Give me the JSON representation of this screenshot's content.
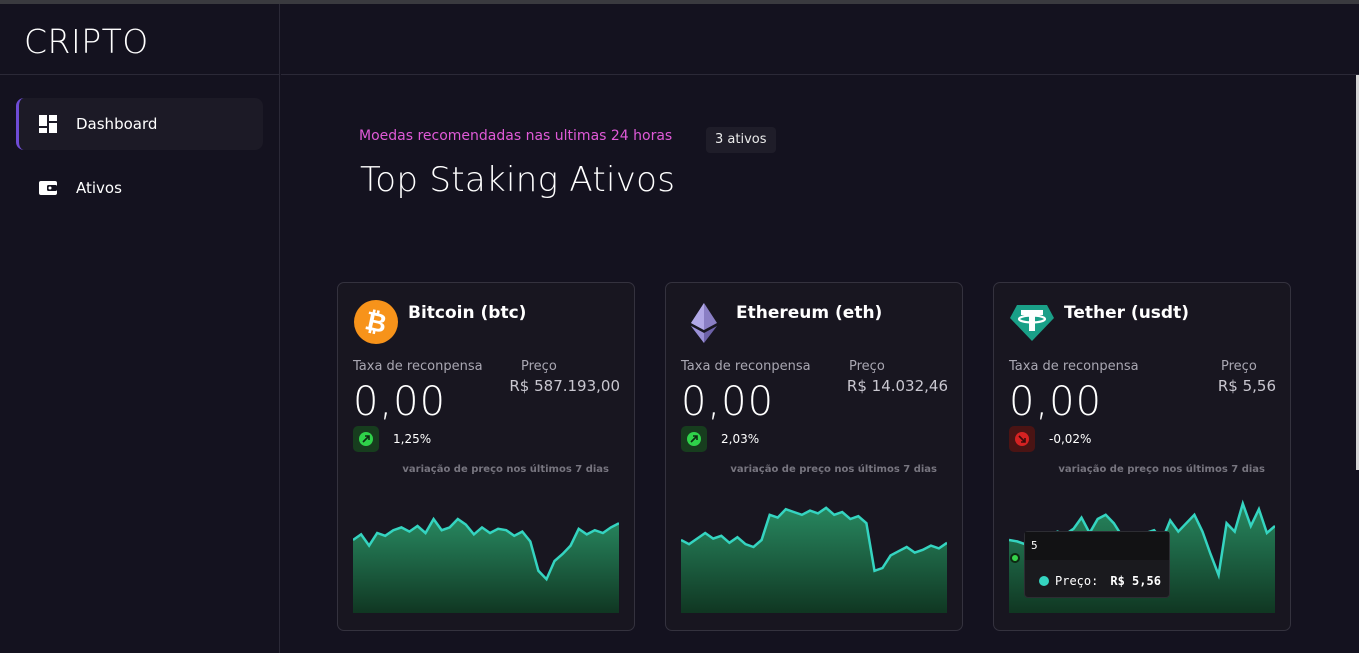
{
  "app": {
    "brand": "CRIPTO"
  },
  "sidebar": {
    "items": [
      {
        "label": "Dashboard",
        "icon": "dashboard-icon",
        "active": true
      },
      {
        "label": "Ativos",
        "icon": "wallet-icon",
        "active": false
      }
    ]
  },
  "header": {
    "subtitle": "Moedas recomendadas nas ultimas 24 horas",
    "badge": "3 ativos",
    "title": "Top Staking Ativos"
  },
  "labels": {
    "reward": "Taxa de reconpensa",
    "price": "Preço",
    "chart_note": "variação de preço nos últimos 7 dias"
  },
  "cards": [
    {
      "name": "Bitcoin (btc)",
      "icon": "bitcoin-icon",
      "reward": "0,00",
      "price": "R$ 587.193,00",
      "change": "1,25%",
      "direction": "up"
    },
    {
      "name": "Ethereum (eth)",
      "icon": "ethereum-icon",
      "reward": "0,00",
      "price": "R$ 14.032,46",
      "change": "2,03%",
      "direction": "up"
    },
    {
      "name": "Tether (usdt)",
      "icon": "tether-icon",
      "reward": "0,00",
      "price": "R$ 5,56",
      "change": "-0,02%",
      "direction": "down"
    }
  ],
  "tooltip": {
    "index": "5",
    "label": "Preço:",
    "value": "R$ 5,56"
  },
  "colors": {
    "accent": "#6f4cd6",
    "subtitle": "#e05ad8",
    "line": "#35d4c0",
    "up": "#2fd24a",
    "down": "#d42222"
  },
  "chart_data": [
    {
      "type": "area",
      "series": [
        {
          "values": [
            40,
            44,
            36,
            45,
            43,
            47,
            49,
            46,
            50,
            45,
            55,
            47,
            49,
            55,
            51,
            44,
            49,
            45,
            48,
            47,
            43,
            46,
            39,
            18,
            12,
            25,
            30,
            36,
            48,
            44,
            47,
            45,
            49,
            52
          ]
        }
      ]
    },
    {
      "type": "area",
      "series": [
        {
          "values": [
            40,
            37,
            41,
            45,
            41,
            43,
            38,
            42,
            37,
            35,
            40,
            58,
            56,
            62,
            60,
            58,
            61,
            59,
            63,
            58,
            60,
            55,
            57,
            52,
            18,
            20,
            29,
            32,
            35,
            31,
            33,
            36,
            34,
            38
          ]
        }
      ]
    },
    {
      "type": "area",
      "series": [
        {
          "values": [
            40,
            39,
            37,
            35,
            38,
            42,
            46,
            44,
            48,
            56,
            45,
            55,
            58,
            52,
            43,
            36,
            20,
            45,
            47,
            40,
            54,
            46,
            52,
            58,
            46,
            30,
            15,
            52,
            46,
            66,
            50,
            62,
            45,
            50
          ]
        }
      ]
    }
  ]
}
